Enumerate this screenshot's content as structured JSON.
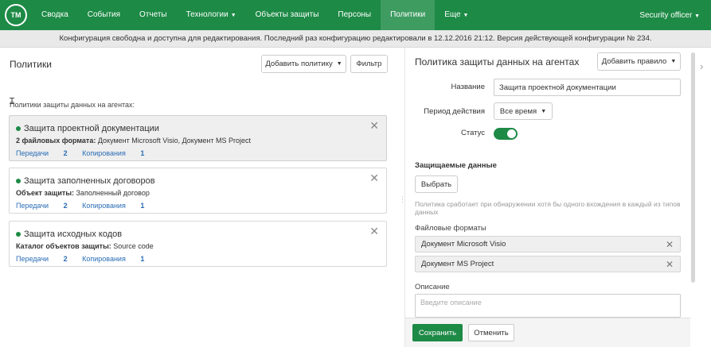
{
  "nav": {
    "logo_text": "TM",
    "items": [
      {
        "label": "Сводка",
        "caret": ""
      },
      {
        "label": "События",
        "caret": ""
      },
      {
        "label": "Отчеты",
        "caret": ""
      },
      {
        "label": "Технологии",
        "caret": "▼"
      },
      {
        "label": "Объекты защиты",
        "caret": ""
      },
      {
        "label": "Персоны",
        "caret": ""
      },
      {
        "label": "Политики",
        "caret": ""
      },
      {
        "label": "Еще",
        "caret": "▼"
      }
    ],
    "active_index": 6,
    "user": "Security officer",
    "user_caret": "▼"
  },
  "infobar": {
    "text": "Конфигурация свободна и доступна для редактирования. Последний раз конфигурацию редактировали в 12.12.2016 21:12. Версия действующей конфигурации № 234."
  },
  "left": {
    "title": "Политики",
    "add_policy_label": "Добавить политику",
    "filter_label": "Фильтр",
    "group_label": "Политики защиты данных на агентах:",
    "cursor_glyph": "Ɪ",
    "policies": [
      {
        "name": "Защита проектной документации",
        "sub_label": "2 файловых формата:",
        "sub_value": " Документ Microsoft Visio, Документ MS Project",
        "transfers_label": "Передачи",
        "transfers": "2",
        "copies_label": "Копирования",
        "copies": "1",
        "selected": true
      },
      {
        "name": "Защита заполненных договоров",
        "sub_label": "Объект защиты:",
        "sub_value": " Заполненный договор",
        "transfers_label": "Передачи",
        "transfers": "2",
        "copies_label": "Копирования",
        "copies": "1",
        "selected": false
      },
      {
        "name": "Защита исходных кодов",
        "sub_label": "Каталог объектов защиты:",
        "sub_value": " Source code",
        "transfers_label": "Передачи",
        "transfers": "2",
        "copies_label": "Копирования",
        "copies": "1",
        "selected": false
      }
    ],
    "close_glyph": "✕"
  },
  "right": {
    "title": "Политика защиты данных на агентах",
    "add_rule_label": "Добавить правило",
    "name_label": "Название",
    "name_value": "Защита проектной документации",
    "period_label": "Период действия",
    "period_value": "Все время",
    "status_label": "Статус",
    "status_on": true,
    "protected_title": "Защищаемые данные",
    "choose_label": "Выбрать",
    "hint": "Политика сработает при обнаружении хотя бы одного вхождения в каждый из типов данных",
    "formats_label": "Файловые форматы",
    "formats": [
      "Документ Microsoft Visio",
      "Документ MS Project"
    ],
    "description_label": "Описание",
    "description_placeholder": "Введите описание",
    "save_label": "Сохранить",
    "cancel_label": "Отменить"
  },
  "colors": {
    "brand_green": "#1d8a46",
    "link_blue": "#2a6db5"
  },
  "icons": {
    "caret": "▼",
    "chevron_right": "›",
    "splitter": "⋮"
  }
}
